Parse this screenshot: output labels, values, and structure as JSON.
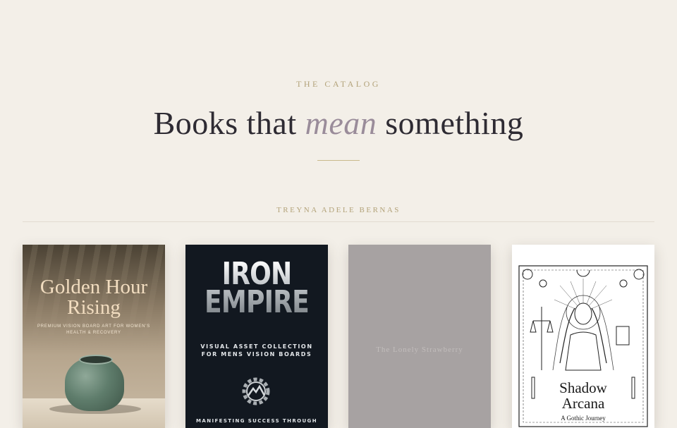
{
  "header": {
    "eyebrow": "THE CATALOG",
    "title_before": "Books that ",
    "title_emphasis": "mean",
    "title_after": " something"
  },
  "section": {
    "author": "TREYNA ADELE BERNAS"
  },
  "books": [
    {
      "cover_title": "Golden Hour Rising",
      "cover_subtitle": "PREMIUM VISION BOARD ART FOR WOMEN'S HEALTH & RECOVERY"
    },
    {
      "cover_title_line1": "IRON",
      "cover_title_line2": "EMPIRE",
      "cover_subtitle": "VISUAL ASSET COLLECTION FOR MENS VISION BOARDS",
      "cover_footer": "MANIFESTING SUCCESS THROUGH"
    },
    {
      "cover_title": "The Lonely Strawberry"
    },
    {
      "cover_title_line1": "Shadow",
      "cover_title_line2": "Arcana",
      "cover_subtitle": "A Gothic Journey"
    }
  ],
  "colors": {
    "background": "#f3efe8",
    "accent_gold": "#b3a37a",
    "title_ink": "#2e2b33",
    "emphasis_mauve": "#9a8c9a"
  }
}
